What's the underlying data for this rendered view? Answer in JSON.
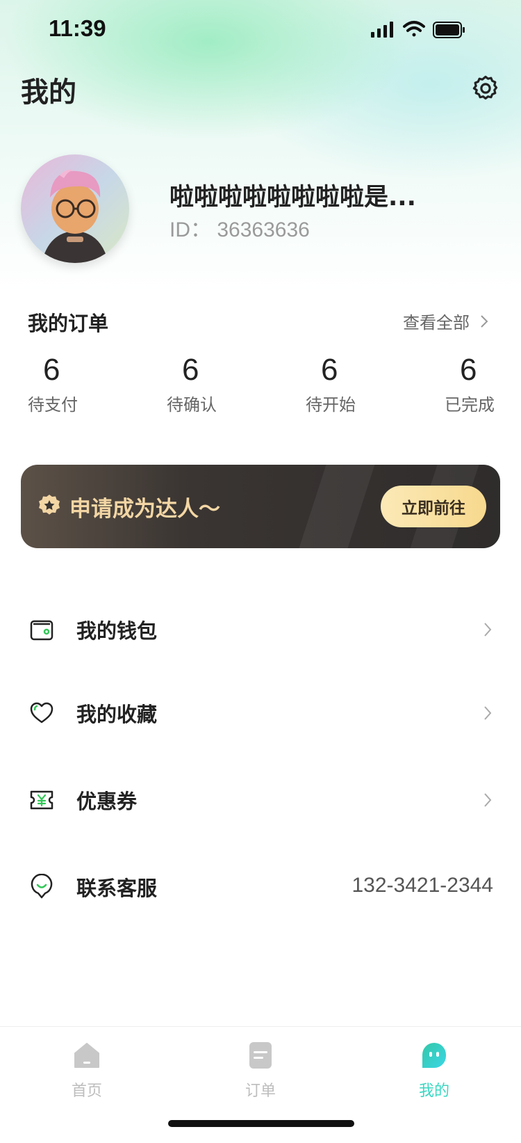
{
  "status_bar": {
    "time": "11:39"
  },
  "header": {
    "title": "我的"
  },
  "profile": {
    "name": "啦啦啦啦啦啦啦啦是...",
    "id_label": "ID：",
    "id_value": "36363636"
  },
  "orders": {
    "title": "我的订单",
    "view_all": "查看全部",
    "stats": [
      {
        "count": "6",
        "label": "待支付"
      },
      {
        "count": "6",
        "label": "待确认"
      },
      {
        "count": "6",
        "label": "待开始"
      },
      {
        "count": "6",
        "label": "已完成"
      }
    ]
  },
  "banner": {
    "text": "申请成为达人～",
    "button": "立即前往"
  },
  "menu": [
    {
      "label": "我的钱包",
      "icon": "wallet-icon"
    },
    {
      "label": "我的收藏",
      "icon": "heart-icon"
    },
    {
      "label": "优惠券",
      "icon": "coupon-icon"
    },
    {
      "label": "联系客服",
      "icon": "customer-service-icon",
      "value": "132-3421-2344"
    }
  ],
  "tabbar": [
    {
      "label": "首页",
      "icon": "home-icon",
      "active": false
    },
    {
      "label": "订单",
      "icon": "order-icon",
      "active": false
    },
    {
      "label": "我的",
      "icon": "profile-icon",
      "active": true
    }
  ],
  "colors": {
    "accent": "#3ad7c2",
    "green": "#34c759",
    "banner_gold": "#f3d6a4"
  }
}
